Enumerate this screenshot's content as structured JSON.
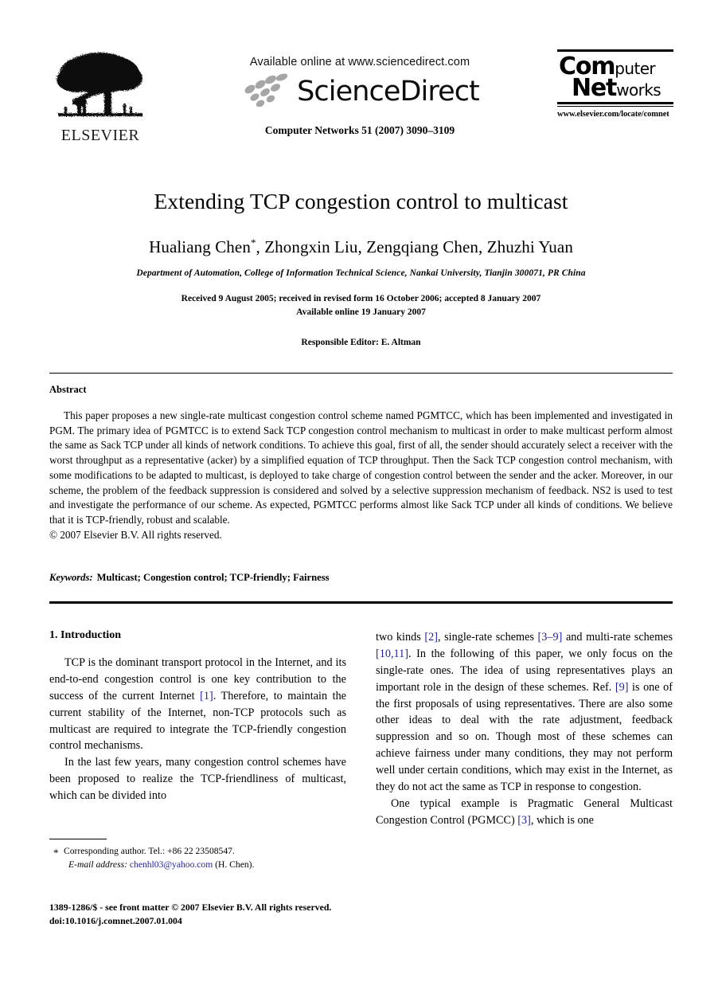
{
  "masthead": {
    "publisher_name": "ELSEVIER",
    "publisher_logo_icon": "elsevier-tree-logo",
    "available_online": "Available online at www.sciencedirect.com",
    "sciencedirect_wordmark": "ScienceDirect",
    "sciencedirect_swoosh_icon": "sciencedirect-swoosh-icon",
    "journal_citation": "Computer Networks 51 (2007) 3090–3109",
    "journal_logo": {
      "line1_big": "Com",
      "line1_small": "puter",
      "line2_big": "Net",
      "line2_small": "works"
    },
    "journal_url": "www.elsevier.com/locate/comnet"
  },
  "title_block": {
    "title": "Extending TCP congestion control to multicast",
    "authors": "Hualiang Chen",
    "authors_marker": "*",
    "authors_rest": ", Zhongxin Liu, Zengqiang Chen, Zhuzhi Yuan",
    "affiliation": "Department of Automation, College of Information Technical Science, Nankai University, Tianjin 300071, PR China",
    "received_line": "Received 9 August 2005; received in revised form 16 October 2006; accepted 8 January 2007",
    "available_line": "Available online 19 January 2007",
    "editor_line": "Responsible Editor: E. Altman"
  },
  "abstract": {
    "heading": "Abstract",
    "body": "This paper proposes a new single-rate multicast congestion control scheme named PGMTCC, which has been implemented and investigated in PGM. The primary idea of PGMTCC is to extend Sack TCP congestion control mechanism to multicast in order to make multicast perform almost the same as Sack TCP under all kinds of network conditions. To achieve this goal, first of all, the sender should accurately select a receiver with the worst throughput as a representative (acker) by a simplified equation of TCP throughput. Then the Sack TCP congestion control mechanism, with some modifications to be adapted to multicast, is deployed to take charge of congestion control between the sender and the acker. Moreover, in our scheme, the problem of the feedback suppression is considered and solved by a selective suppression mechanism of feedback. NS2 is used to test and investigate the performance of our scheme. As expected, PGMTCC performs almost like Sack TCP under all kinds of conditions. We believe that it is TCP-friendly, robust and scalable.",
    "copyright": "© 2007 Elsevier B.V. All rights reserved."
  },
  "keywords": {
    "label": "Keywords:",
    "values": "Multicast; Congestion control; TCP-friendly; Fairness"
  },
  "body": {
    "section1_heading": "1. Introduction",
    "left_paragraph_1_a": "TCP is the dominant transport protocol in the Internet, and its end-to-end congestion control is one key contribution to the success of the current Internet ",
    "left_paragraph_1_cite": "[1]",
    "left_paragraph_1_b": ". Therefore, to maintain the current stability of the Internet, non-TCP protocols such as multicast are required to integrate the TCP-friendly congestion control mechanisms.",
    "left_paragraph_2": "In the last few years, many congestion control schemes have been proposed to realize the TCP-friendliness of multicast, which can be divided into",
    "right_paragraph_1_a": "two kinds ",
    "right_paragraph_1_cite1": "[2]",
    "right_paragraph_1_b": ", single-rate schemes ",
    "right_paragraph_1_cite2": "[3–9]",
    "right_paragraph_1_c": " and multi-rate schemes ",
    "right_paragraph_1_cite3": "[10,11]",
    "right_paragraph_1_d": ". In the following of this paper, we only focus on the single-rate ones. The idea of using representatives plays an important role in the design of these schemes. Ref. ",
    "right_paragraph_1_cite4": "[9]",
    "right_paragraph_1_e": " is one of the first proposals of using representatives. There are also some other ideas to deal with the rate adjustment, feedback suppression and so on. Though most of these schemes can achieve fairness under many conditions, they may not perform well under certain conditions, which may exist in the Internet, as they do not act the same as TCP in response to congestion.",
    "right_paragraph_2_a": "One typical example is Pragmatic General Multicast Congestion Control (PGMCC) ",
    "right_paragraph_2_cite": "[3]",
    "right_paragraph_2_b": ", which is one"
  },
  "footnote": {
    "marker": "*",
    "corresponding": "Corresponding author. Tel.: +86 22 23508547.",
    "email_label": "E-mail address:",
    "email": "chenhl03@yahoo.com",
    "email_owner": "(H. Chen)."
  },
  "footer": {
    "issn_line": "1389-1286/$ - see front matter © 2007 Elsevier B.V. All rights reserved.",
    "doi_line": "doi:10.1016/j.comnet.2007.01.004"
  },
  "colors": {
    "link_blue": "#1f1f9e",
    "text_black": "#000000",
    "page_background": "#ffffff"
  }
}
